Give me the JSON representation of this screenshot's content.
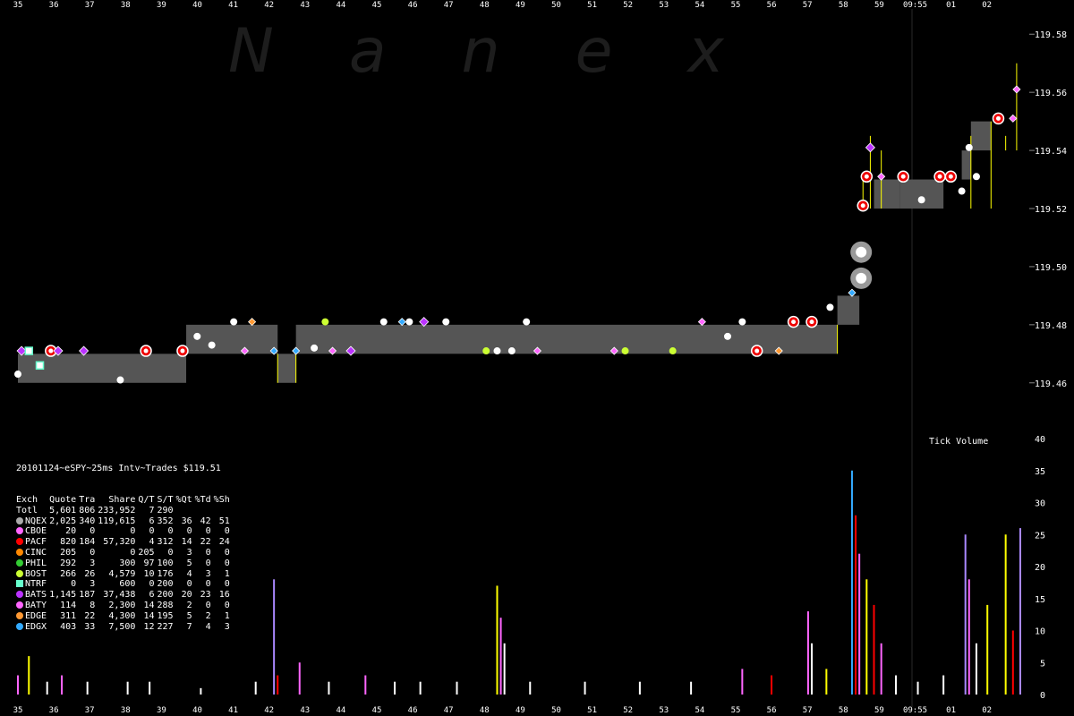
{
  "watermark": "Nanex",
  "chart_data": [
    {
      "type": "line",
      "title": "20101124~eSPY~25ms Intv~Trades $119.51",
      "x_ticks_top": [
        "35",
        "36",
        "37",
        "38",
        "39",
        "40",
        "41",
        "42",
        "43",
        "44",
        "45",
        "46",
        "47",
        "48",
        "49",
        "50",
        "51",
        "52",
        "53",
        "54",
        "55",
        "56",
        "57",
        "58",
        "59",
        "09:55",
        "01",
        "02"
      ],
      "y_ticks": [
        "119.58",
        "119.56",
        "119.54",
        "119.52",
        "119.50",
        "119.48",
        "119.46"
      ],
      "ylim": [
        119.455,
        119.585
      ],
      "nbbo_band": [
        {
          "x0": 35.0,
          "x1": 39.6,
          "bid": 119.46,
          "ask": 119.47
        },
        {
          "x0": 39.6,
          "x1": 42.1,
          "bid": 119.47,
          "ask": 119.48
        },
        {
          "x0": 42.1,
          "x1": 42.6,
          "bid": 119.46,
          "ask": 119.47
        },
        {
          "x0": 42.6,
          "x1": 57.4,
          "bid": 119.47,
          "ask": 119.48
        },
        {
          "x0": 57.4,
          "x1": 58.0,
          "bid": 119.48,
          "ask": 119.49
        },
        {
          "x0": 58.4,
          "x1": 59.1,
          "bid": 119.52,
          "ask": 119.53
        },
        {
          "x0": 59.1,
          "x1": 60.3,
          "bid": 119.52,
          "ask": 119.53
        },
        {
          "x0": 60.8,
          "x1": 61.05,
          "bid": 119.53,
          "ask": 119.54
        },
        {
          "x0": 61.05,
          "x1": 61.6,
          "bid": 119.54,
          "ask": 119.55
        }
      ],
      "trades": [
        {
          "x": 35.0,
          "y": 119.463,
          "ex": "NQEX"
        },
        {
          "x": 35.1,
          "y": 119.471,
          "ex": "BATS"
        },
        {
          "x": 35.3,
          "y": 119.471,
          "ex": "NTRF"
        },
        {
          "x": 35.6,
          "y": 119.466,
          "ex": "NTRF"
        },
        {
          "x": 35.9,
          "y": 119.471,
          "ex": "PACF"
        },
        {
          "x": 36.1,
          "y": 119.471,
          "ex": "BATS"
        },
        {
          "x": 36.8,
          "y": 119.471,
          "ex": "BATS"
        },
        {
          "x": 37.8,
          "y": 119.461,
          "ex": "NQEX"
        },
        {
          "x": 38.5,
          "y": 119.471,
          "ex": "PACF"
        },
        {
          "x": 39.5,
          "y": 119.471,
          "ex": "PACF"
        },
        {
          "x": 39.9,
          "y": 119.476,
          "ex": "NQEX"
        },
        {
          "x": 40.3,
          "y": 119.473,
          "ex": "NQEX"
        },
        {
          "x": 40.9,
          "y": 119.481,
          "ex": "NQEX"
        },
        {
          "x": 41.2,
          "y": 119.471,
          "ex": "BATY"
        },
        {
          "x": 41.4,
          "y": 119.481,
          "ex": "EDGE"
        },
        {
          "x": 42.0,
          "y": 119.471,
          "ex": "EDGX"
        },
        {
          "x": 42.6,
          "y": 119.471,
          "ex": "EDGX"
        },
        {
          "x": 43.1,
          "y": 119.472,
          "ex": "NQEX"
        },
        {
          "x": 43.4,
          "y": 119.481,
          "ex": "BOST"
        },
        {
          "x": 43.6,
          "y": 119.471,
          "ex": "BATY"
        },
        {
          "x": 44.1,
          "y": 119.471,
          "ex": "BATS"
        },
        {
          "x": 45.0,
          "y": 119.481,
          "ex": "NQEX"
        },
        {
          "x": 45.5,
          "y": 119.481,
          "ex": "EDGX"
        },
        {
          "x": 45.7,
          "y": 119.481,
          "ex": "NQEX"
        },
        {
          "x": 46.1,
          "y": 119.481,
          "ex": "BATS"
        },
        {
          "x": 46.7,
          "y": 119.481,
          "ex": "NQEX"
        },
        {
          "x": 47.8,
          "y": 119.471,
          "ex": "BOST"
        },
        {
          "x": 48.1,
          "y": 119.471,
          "ex": "NQEX"
        },
        {
          "x": 48.5,
          "y": 119.471,
          "ex": "NQEX"
        },
        {
          "x": 48.9,
          "y": 119.481,
          "ex": "NQEX"
        },
        {
          "x": 49.2,
          "y": 119.471,
          "ex": "BATY"
        },
        {
          "x": 51.3,
          "y": 119.471,
          "ex": "BATY"
        },
        {
          "x": 51.6,
          "y": 119.471,
          "ex": "BOST"
        },
        {
          "x": 52.9,
          "y": 119.471,
          "ex": "BOST"
        },
        {
          "x": 53.7,
          "y": 119.481,
          "ex": "BATY"
        },
        {
          "x": 54.4,
          "y": 119.476,
          "ex": "NQEX"
        },
        {
          "x": 54.8,
          "y": 119.481,
          "ex": "NQEX"
        },
        {
          "x": 55.2,
          "y": 119.471,
          "ex": "PACF"
        },
        {
          "x": 55.8,
          "y": 119.471,
          "ex": "EDGE"
        },
        {
          "x": 56.2,
          "y": 119.481,
          "ex": "PACF"
        },
        {
          "x": 56.7,
          "y": 119.481,
          "ex": "PACF"
        },
        {
          "x": 57.2,
          "y": 119.486,
          "ex": "NQEX"
        },
        {
          "x": 57.8,
          "y": 119.491,
          "ex": "EDGX"
        },
        {
          "x": 58.0,
          "y": 119.505,
          "ex": "NQEX"
        },
        {
          "x": 58.1,
          "y": 119.521,
          "ex": "PACF"
        },
        {
          "x": 58.2,
          "y": 119.531,
          "ex": "PACF"
        },
        {
          "x": 58.3,
          "y": 119.541,
          "ex": "BATS"
        },
        {
          "x": 58.6,
          "y": 119.531,
          "ex": "BATY"
        },
        {
          "x": 59.2,
          "y": 119.531,
          "ex": "PACF"
        },
        {
          "x": 59.7,
          "y": 119.523,
          "ex": "NQEX"
        },
        {
          "x": 60.2,
          "y": 119.531,
          "ex": "PACF"
        },
        {
          "x": 60.5,
          "y": 119.531,
          "ex": "PACF"
        },
        {
          "x": 60.8,
          "y": 119.526,
          "ex": "NQEX"
        },
        {
          "x": 61.0,
          "y": 119.541,
          "ex": "NQEX"
        },
        {
          "x": 61.2,
          "y": 119.531,
          "ex": "NQEX"
        },
        {
          "x": 61.8,
          "y": 119.551,
          "ex": "PACF"
        },
        {
          "x": 62.2,
          "y": 119.551,
          "ex": "BATY"
        },
        {
          "x": 62.3,
          "y": 119.561,
          "ex": "BATY"
        }
      ]
    },
    {
      "type": "bar",
      "title": "Tick Volume",
      "x_ticks_bottom": [
        "35",
        "36",
        "37",
        "38",
        "39",
        "40",
        "41",
        "42",
        "43",
        "44",
        "45",
        "46",
        "47",
        "48",
        "49",
        "50",
        "51",
        "52",
        "53",
        "54",
        "55",
        "56",
        "57",
        "58",
        "59",
        "09:55",
        "01",
        "02"
      ],
      "y_ticks": [
        "40",
        "35",
        "30",
        "25",
        "20",
        "15",
        "10",
        "5",
        "0"
      ],
      "ylim": [
        0,
        40
      ],
      "bars": [
        {
          "x": 35.0,
          "v": 3,
          "c": "#ff66ff"
        },
        {
          "x": 35.3,
          "v": 6,
          "c": "#ffff00"
        },
        {
          "x": 35.8,
          "v": 2,
          "c": "#ffffff"
        },
        {
          "x": 36.2,
          "v": 3,
          "c": "#ff66ff"
        },
        {
          "x": 36.9,
          "v": 2,
          "c": "#ffffff"
        },
        {
          "x": 38.0,
          "v": 2,
          "c": "#ffffff"
        },
        {
          "x": 38.6,
          "v": 2,
          "c": "#ffffff"
        },
        {
          "x": 40.0,
          "v": 1,
          "c": "#ffffff"
        },
        {
          "x": 41.5,
          "v": 2,
          "c": "#ffffff"
        },
        {
          "x": 42.0,
          "v": 18,
          "c": "#aa88ff"
        },
        {
          "x": 42.1,
          "v": 3,
          "c": "#ff0000"
        },
        {
          "x": 42.7,
          "v": 5,
          "c": "#ff66ff"
        },
        {
          "x": 43.5,
          "v": 2,
          "c": "#ffffff"
        },
        {
          "x": 44.5,
          "v": 3,
          "c": "#ff66ff"
        },
        {
          "x": 45.3,
          "v": 2,
          "c": "#ffffff"
        },
        {
          "x": 46.0,
          "v": 2,
          "c": "#ffffff"
        },
        {
          "x": 47.0,
          "v": 2,
          "c": "#ffffff"
        },
        {
          "x": 48.1,
          "v": 17,
          "c": "#ffff00"
        },
        {
          "x": 48.2,
          "v": 12,
          "c": "#ff66ff"
        },
        {
          "x": 48.3,
          "v": 8,
          "c": "#ffffff"
        },
        {
          "x": 49.0,
          "v": 2,
          "c": "#ffffff"
        },
        {
          "x": 50.5,
          "v": 2,
          "c": "#ffffff"
        },
        {
          "x": 52.0,
          "v": 2,
          "c": "#ffffff"
        },
        {
          "x": 53.4,
          "v": 2,
          "c": "#ffffff"
        },
        {
          "x": 54.8,
          "v": 4,
          "c": "#ff66ff"
        },
        {
          "x": 55.6,
          "v": 3,
          "c": "#ff0000"
        },
        {
          "x": 56.6,
          "v": 13,
          "c": "#ff66ff"
        },
        {
          "x": 56.7,
          "v": 8,
          "c": "#ffffff"
        },
        {
          "x": 57.1,
          "v": 4,
          "c": "#ffff00"
        },
        {
          "x": 57.8,
          "v": 35,
          "c": "#33aaff"
        },
        {
          "x": 57.9,
          "v": 28,
          "c": "#ff0000"
        },
        {
          "x": 58.0,
          "v": 22,
          "c": "#ff66ff"
        },
        {
          "x": 58.2,
          "v": 18,
          "c": "#ffff00"
        },
        {
          "x": 58.4,
          "v": 14,
          "c": "#ff0000"
        },
        {
          "x": 58.6,
          "v": 8,
          "c": "#ff66ff"
        },
        {
          "x": 59.0,
          "v": 3,
          "c": "#ffffff"
        },
        {
          "x": 59.6,
          "v": 2,
          "c": "#ffffff"
        },
        {
          "x": 60.3,
          "v": 3,
          "c": "#ffffff"
        },
        {
          "x": 60.9,
          "v": 25,
          "c": "#aa88ff"
        },
        {
          "x": 61.0,
          "v": 18,
          "c": "#ff66ff"
        },
        {
          "x": 61.2,
          "v": 8,
          "c": "#ffffff"
        },
        {
          "x": 61.5,
          "v": 14,
          "c": "#ffff00"
        },
        {
          "x": 62.0,
          "v": 25,
          "c": "#ffff00"
        },
        {
          "x": 62.2,
          "v": 10,
          "c": "#ff0000"
        },
        {
          "x": 62.4,
          "v": 26,
          "c": "#aa88ff"
        }
      ]
    }
  ],
  "stats": {
    "title": "20101124~eSPY~25ms Intv~Trades $119.51",
    "columns": [
      "Exch",
      "Quote",
      "Tra",
      "Share",
      "Q/T",
      "S/T",
      "%Qt",
      "%Td",
      "%Sh"
    ],
    "rows": [
      {
        "ex": "Totl",
        "color": "",
        "quote": "5,601",
        "tra": "806",
        "share": "233,952",
        "qt": "7",
        "st": "290",
        "pq": "",
        "pt": "",
        "ps": ""
      },
      {
        "ex": "NQEX",
        "color": "#aaaaaa",
        "quote": "2,025",
        "tra": "340",
        "share": "119,615",
        "qt": "6",
        "st": "352",
        "pq": "36",
        "pt": "42",
        "ps": "51"
      },
      {
        "ex": "CBOE",
        "color": "#ff66ff",
        "quote": "20",
        "tra": "0",
        "share": "0",
        "qt": "0",
        "st": "0",
        "pq": "0",
        "pt": "0",
        "ps": "0"
      },
      {
        "ex": "PACF",
        "color": "#ff0000",
        "quote": "820",
        "tra": "184",
        "share": "57,320",
        "qt": "4",
        "st": "312",
        "pq": "14",
        "pt": "22",
        "ps": "24"
      },
      {
        "ex": "CINC",
        "color": "#ff8800",
        "quote": "205",
        "tra": "0",
        "share": "0",
        "qt": "205",
        "st": "0",
        "pq": "3",
        "pt": "0",
        "ps": "0"
      },
      {
        "ex": "PHIL",
        "color": "#33cc33",
        "quote": "292",
        "tra": "3",
        "share": "300",
        "qt": "97",
        "st": "100",
        "pq": "5",
        "pt": "0",
        "ps": "0"
      },
      {
        "ex": "BOST",
        "color": "#ccff33",
        "quote": "266",
        "tra": "26",
        "share": "4,579",
        "qt": "10",
        "st": "176",
        "pq": "4",
        "pt": "3",
        "ps": "1"
      },
      {
        "ex": "NTRF",
        "color": "#66ffcc",
        "quote": "0",
        "tra": "3",
        "share": "600",
        "qt": "0",
        "st": "200",
        "pq": "0",
        "pt": "0",
        "ps": "0"
      },
      {
        "ex": "BATS",
        "color": "#bb33ff",
        "quote": "1,145",
        "tra": "187",
        "share": "37,438",
        "qt": "6",
        "st": "200",
        "pq": "20",
        "pt": "23",
        "ps": "16"
      },
      {
        "ex": "BATY",
        "color": "#ff66ff",
        "quote": "114",
        "tra": "8",
        "share": "2,300",
        "qt": "14",
        "st": "288",
        "pq": "2",
        "pt": "0",
        "ps": "0"
      },
      {
        "ex": "EDGE",
        "color": "#ff9933",
        "quote": "311",
        "tra": "22",
        "share": "4,300",
        "qt": "14",
        "st": "195",
        "pq": "5",
        "pt": "2",
        "ps": "1"
      },
      {
        "ex": "EDGX",
        "color": "#33aaff",
        "quote": "403",
        "tra": "33",
        "share": "7,500",
        "qt": "12",
        "st": "227",
        "pq": "7",
        "pt": "4",
        "ps": "3"
      }
    ]
  },
  "colors": {
    "background": "#000000",
    "band": "#555555",
    "trade_line": "#ffff00",
    "axis_text": "#ffffff"
  }
}
